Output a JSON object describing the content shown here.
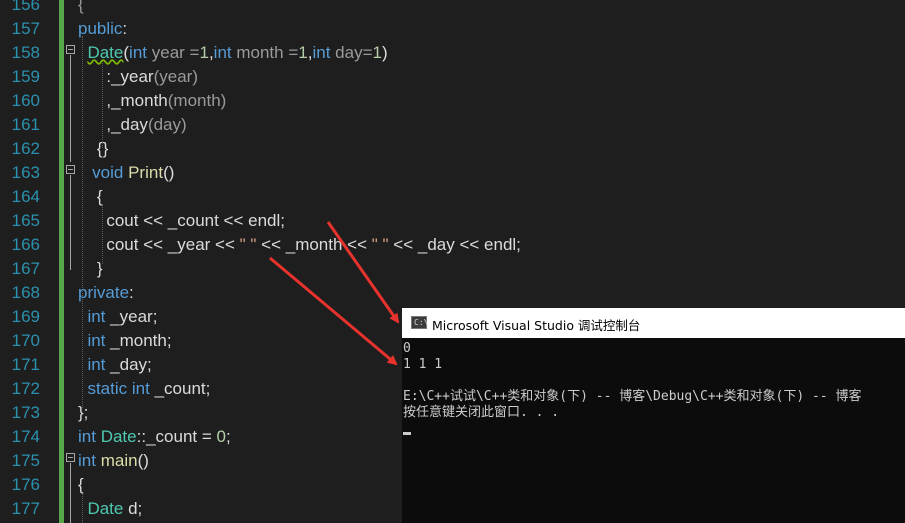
{
  "editor": {
    "lines": [
      {
        "n": "156",
        "segments": [
          {
            "t": "{",
            "c": "p"
          }
        ]
      },
      {
        "n": "157",
        "segments": [
          {
            "t": "public",
            "c": "k"
          },
          {
            "t": ":",
            "c": ""
          }
        ]
      },
      {
        "n": "158",
        "segments": [
          {
            "t": "  ",
            "c": ""
          },
          {
            "t": "Date",
            "c": "t squig"
          },
          {
            "t": "(",
            "c": ""
          },
          {
            "t": "int",
            "c": "k"
          },
          {
            "t": " year =",
            "c": "p"
          },
          {
            "t": "1",
            "c": "n"
          },
          {
            "t": ",",
            "c": ""
          },
          {
            "t": "int",
            "c": "k"
          },
          {
            "t": " month =",
            "c": "p"
          },
          {
            "t": "1",
            "c": "n"
          },
          {
            "t": ",",
            "c": ""
          },
          {
            "t": "int",
            "c": "k"
          },
          {
            "t": " day=",
            "c": "p"
          },
          {
            "t": "1",
            "c": "n"
          },
          {
            "t": ")",
            "c": ""
          }
        ]
      },
      {
        "n": "159",
        "segments": [
          {
            "t": "      :",
            "c": ""
          },
          {
            "t": "_year",
            "c": "m"
          },
          {
            "t": "(year)",
            "c": "p"
          }
        ]
      },
      {
        "n": "160",
        "segments": [
          {
            "t": "      ,",
            "c": ""
          },
          {
            "t": "_month",
            "c": "m"
          },
          {
            "t": "(month)",
            "c": "p"
          }
        ]
      },
      {
        "n": "161",
        "segments": [
          {
            "t": "      ,",
            "c": ""
          },
          {
            "t": "_day",
            "c": "m"
          },
          {
            "t": "(day)",
            "c": "p"
          }
        ]
      },
      {
        "n": "162",
        "segments": [
          {
            "t": "    {}",
            "c": ""
          }
        ]
      },
      {
        "n": "163",
        "segments": [
          {
            "t": "   ",
            "c": ""
          },
          {
            "t": "void",
            "c": "k"
          },
          {
            "t": " ",
            "c": ""
          },
          {
            "t": "Print",
            "c": "f"
          },
          {
            "t": "()",
            "c": ""
          }
        ]
      },
      {
        "n": "164",
        "segments": [
          {
            "t": "    {",
            "c": ""
          }
        ]
      },
      {
        "n": "165",
        "segments": [
          {
            "t": "      cout << ",
            "c": ""
          },
          {
            "t": "_count",
            "c": "m"
          },
          {
            "t": " << endl;",
            "c": ""
          }
        ]
      },
      {
        "n": "166",
        "segments": [
          {
            "t": "      cout << ",
            "c": ""
          },
          {
            "t": "_year",
            "c": "m"
          },
          {
            "t": " << ",
            "c": ""
          },
          {
            "t": "\" \"",
            "c": "s"
          },
          {
            "t": " << ",
            "c": ""
          },
          {
            "t": "_month",
            "c": "m"
          },
          {
            "t": " << ",
            "c": ""
          },
          {
            "t": "\" \"",
            "c": "s"
          },
          {
            "t": " << ",
            "c": ""
          },
          {
            "t": "_day",
            "c": "m"
          },
          {
            "t": " << endl;",
            "c": ""
          }
        ]
      },
      {
        "n": "167",
        "segments": [
          {
            "t": "    }",
            "c": ""
          }
        ]
      },
      {
        "n": "168",
        "segments": [
          {
            "t": "private",
            "c": "k"
          },
          {
            "t": ":",
            "c": ""
          }
        ]
      },
      {
        "n": "169",
        "segments": [
          {
            "t": "  ",
            "c": ""
          },
          {
            "t": "int",
            "c": "k"
          },
          {
            "t": " ",
            "c": ""
          },
          {
            "t": "_year",
            "c": "m"
          },
          {
            "t": ";",
            "c": ""
          }
        ]
      },
      {
        "n": "170",
        "segments": [
          {
            "t": "  ",
            "c": ""
          },
          {
            "t": "int",
            "c": "k"
          },
          {
            "t": " ",
            "c": ""
          },
          {
            "t": "_month",
            "c": "m"
          },
          {
            "t": ";",
            "c": ""
          }
        ]
      },
      {
        "n": "171",
        "segments": [
          {
            "t": "  ",
            "c": ""
          },
          {
            "t": "int",
            "c": "k"
          },
          {
            "t": " ",
            "c": ""
          },
          {
            "t": "_day",
            "c": "m"
          },
          {
            "t": ";",
            "c": ""
          }
        ]
      },
      {
        "n": "172",
        "segments": [
          {
            "t": "  ",
            "c": ""
          },
          {
            "t": "static",
            "c": "k"
          },
          {
            "t": " ",
            "c": ""
          },
          {
            "t": "int",
            "c": "k"
          },
          {
            "t": " ",
            "c": ""
          },
          {
            "t": "_count",
            "c": "m"
          },
          {
            "t": ";",
            "c": ""
          }
        ]
      },
      {
        "n": "173",
        "segments": [
          {
            "t": "};",
            "c": ""
          }
        ]
      },
      {
        "n": "174",
        "segments": [
          {
            "t": "int",
            "c": "k"
          },
          {
            "t": " ",
            "c": ""
          },
          {
            "t": "Date",
            "c": "t"
          },
          {
            "t": "::",
            "c": ""
          },
          {
            "t": "_count",
            "c": "m"
          },
          {
            "t": " = ",
            "c": ""
          },
          {
            "t": "0",
            "c": "n"
          },
          {
            "t": ";",
            "c": ""
          }
        ]
      },
      {
        "n": "175",
        "segments": [
          {
            "t": "int",
            "c": "k"
          },
          {
            "t": " ",
            "c": ""
          },
          {
            "t": "main",
            "c": "f"
          },
          {
            "t": "()",
            "c": ""
          }
        ]
      },
      {
        "n": "176",
        "segments": [
          {
            "t": "{",
            "c": ""
          }
        ]
      },
      {
        "n": "177",
        "segments": [
          {
            "t": "  ",
            "c": ""
          },
          {
            "t": "Date",
            "c": "t"
          },
          {
            "t": " d;",
            "c": ""
          }
        ]
      }
    ]
  },
  "console": {
    "title": "Microsoft Visual Studio 调试控制台",
    "icon_label": "C:\\",
    "output": [
      "0",
      "1 1 1",
      "",
      "E:\\C++试试\\C++类和对象(下) -- 博客\\Debug\\C++类和对象(下) -- 博客",
      "按任意键关闭此窗口. . ."
    ]
  },
  "colors": {
    "background": "#1e1e1e",
    "line_number": "#2b91af",
    "keyword": "#569cd6",
    "type": "#4ec9b0",
    "arrow": "#e8322d"
  }
}
